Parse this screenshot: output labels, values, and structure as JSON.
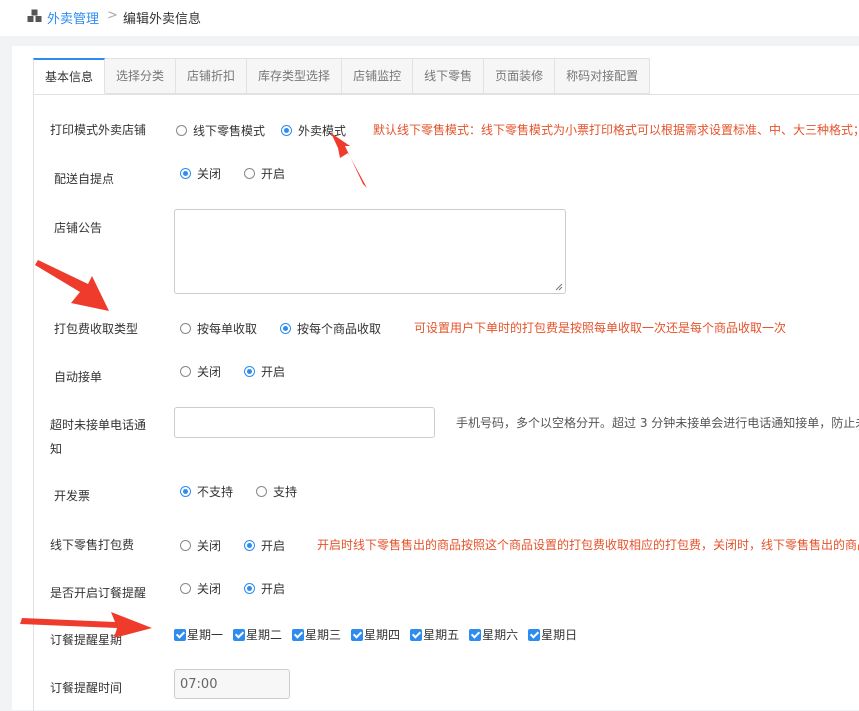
{
  "breadcrumb": {
    "root": "外卖管理",
    "separator": ">",
    "current": "编辑外卖信息"
  },
  "tabs": [
    {
      "label": "基本信息",
      "active": true
    },
    {
      "label": "选择分类",
      "active": false
    },
    {
      "label": "店铺折扣",
      "active": false
    },
    {
      "label": "库存类型选择",
      "active": false
    },
    {
      "label": "店铺监控",
      "active": false
    },
    {
      "label": "线下零售",
      "active": false
    },
    {
      "label": "页面装修",
      "active": false
    },
    {
      "label": "称码对接配置",
      "active": false
    }
  ],
  "form": {
    "print_mode": {
      "label": "打印模式外卖店铺",
      "options": [
        "线下零售模式",
        "外卖模式"
      ],
      "selected": 1,
      "hint": "默认线下零售模式：线下零售模式为小票打印格式可以根据需求设置标准、中、大三种格式；"
    },
    "self_pickup": {
      "label": "配送自提点",
      "options": [
        "关闭",
        "开启"
      ],
      "selected": 0
    },
    "notice": {
      "label": "店铺公告",
      "value": ""
    },
    "packing_fee_type": {
      "label": "打包费收取类型",
      "options": [
        "按每单收取",
        "按每个商品收取"
      ],
      "selected": 1,
      "hint": "可设置用户下单时的打包费是按照每单收取一次还是每个商品收取一次"
    },
    "auto_accept": {
      "label": "自动接单",
      "options": [
        "关闭",
        "开启"
      ],
      "selected": 1
    },
    "timeout_phone": {
      "label_line1": "超时未接单电话通",
      "label_line2": "知",
      "value": "",
      "hint": "手机号码，多个以空格分开。超过 3 分钟未接单会进行电话通知接单，防止未"
    },
    "invoice": {
      "label": "开发票",
      "options": [
        "不支持",
        "支持"
      ],
      "selected": 0
    },
    "offline_packing_fee": {
      "label": "线下零售打包费",
      "options": [
        "关闭",
        "开启"
      ],
      "selected": 1,
      "hint": "开启时线下零售售出的商品按照这个商品设置的打包费收取相应的打包费，关闭时，线下零售售出的商品"
    },
    "order_reminder": {
      "label": "是否开启订餐提醒",
      "options": [
        "关闭",
        "开启"
      ],
      "selected": 1
    },
    "reminder_days": {
      "label": "订餐提醒星期",
      "days": [
        "星期一",
        "星期二",
        "星期三",
        "星期四",
        "星期五",
        "星期六",
        "星期日"
      ]
    },
    "reminder_time": {
      "label": "订餐提醒时间",
      "value": "07:00"
    }
  },
  "colors": {
    "accent": "#2d8cf0",
    "hint_red": "#e4532b",
    "arrow_red": "#ee3b2b"
  }
}
